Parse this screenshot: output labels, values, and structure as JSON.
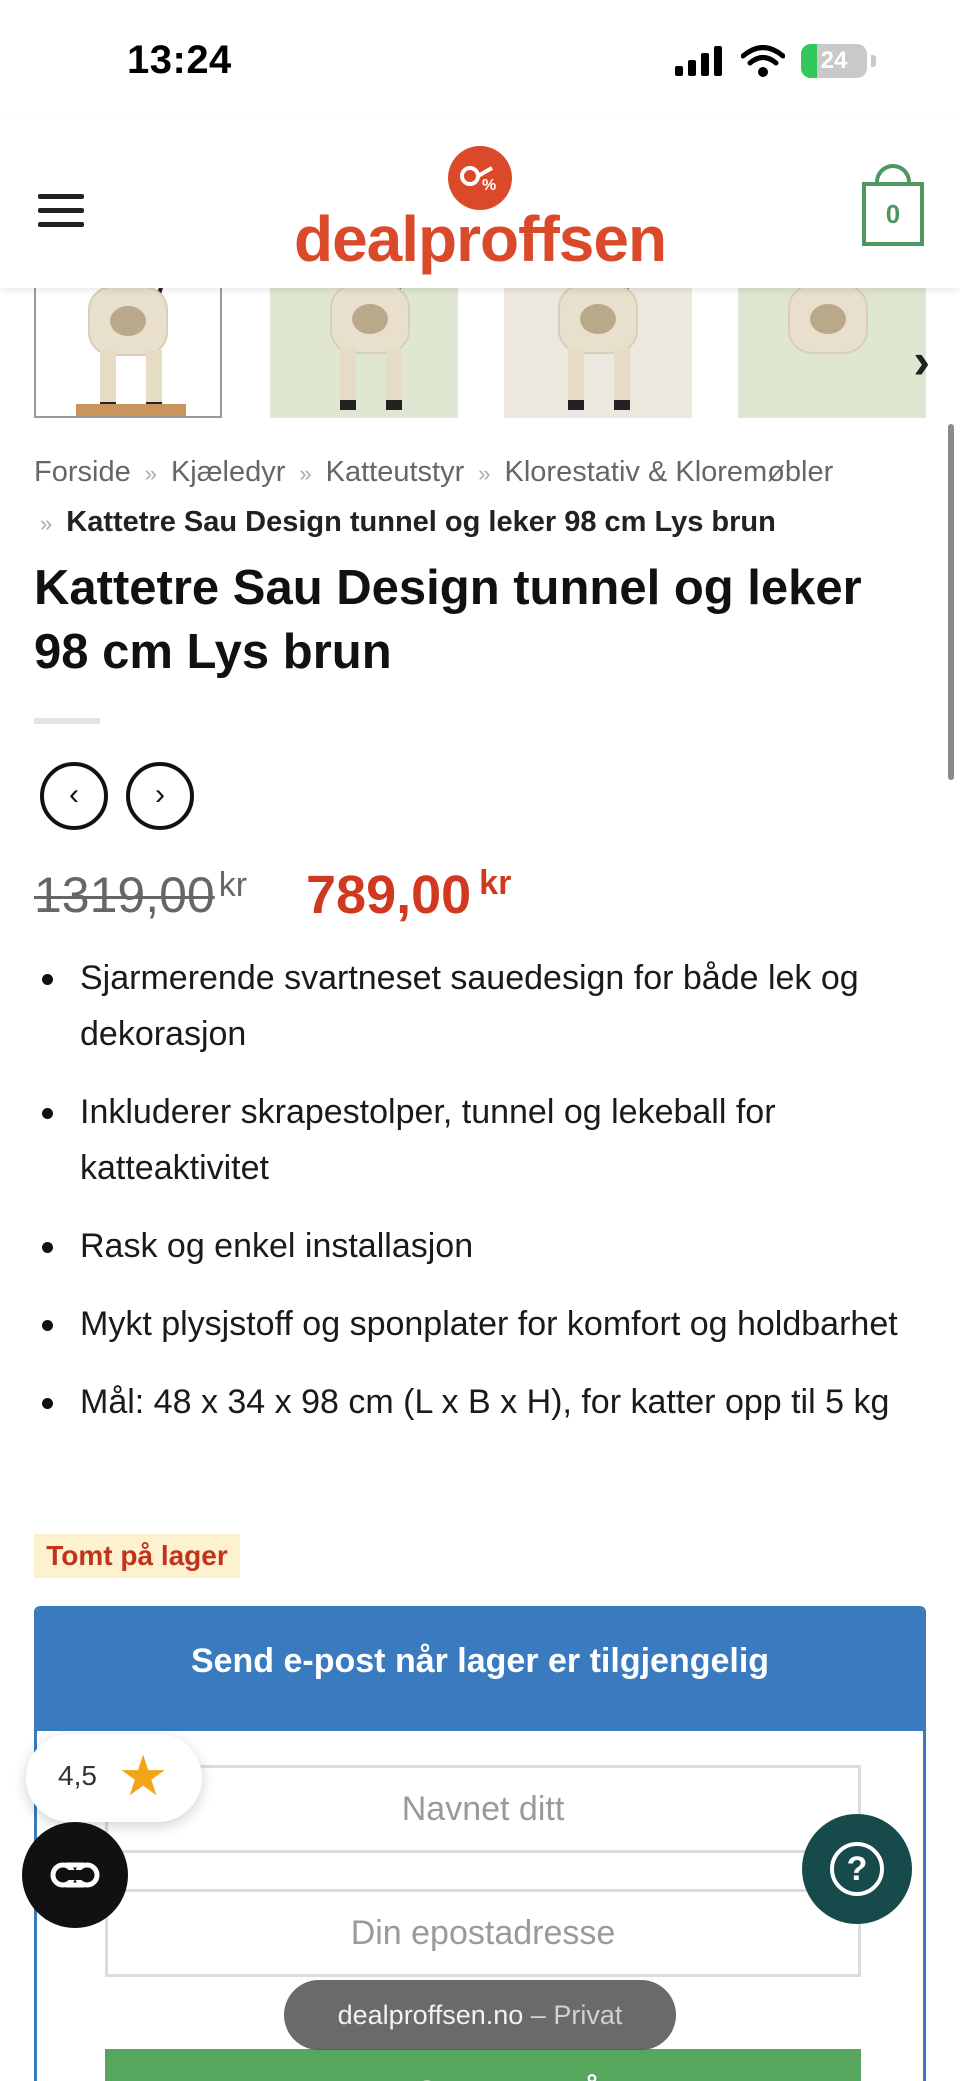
{
  "status_bar": {
    "time": "13:24",
    "battery": "24"
  },
  "header": {
    "logo_text": "dealproffsen",
    "cart_count": "0"
  },
  "breadcrumb": {
    "items": [
      "Forside",
      "Kjæledyr",
      "Katteutstyr",
      "Klorestativ & Kloremøbler"
    ],
    "current": "Kattetre Sau Design tunnel og leker 98 cm Lys brun",
    "separator": "»"
  },
  "product": {
    "title": "Kattetre Sau Design tunnel og leker 98 cm Lys brun",
    "old_price": "1319,00",
    "new_price": "789,00",
    "currency": "kr",
    "features": [
      "Sjarmerende svartneset sauedesign for både lek og dekorasjon",
      "Inkluderer skrapestolper, tunnel og lekeball for katteaktivitet",
      "Rask og enkel installasjon",
      "Mykt plysjstoff og sponplater for komfort og holdbarhet",
      "Mål: 48 x 34 x 98 cm (L x B x H), for katter opp til 5 kg"
    ],
    "stock_status": "Tomt på lager"
  },
  "notify": {
    "heading": "Send e-post når lager er tilgjengelig",
    "name_placeholder": "Navnet ditt",
    "email_placeholder": "Din epostadresse",
    "subscribe_label": "ABONNER NÅ"
  },
  "rating": {
    "value": "4,5"
  },
  "browser": {
    "domain": "dealproffsen.no",
    "mode": "Privat",
    "separator": "–"
  },
  "colors": {
    "brand": "#d9492a",
    "sale_price": "#d0391f",
    "notify_blue": "#3a7bc0",
    "subscribe_green": "#57a65e",
    "cart_green": "#4f9660",
    "help_teal": "#174a4b",
    "star": "#f2a516"
  },
  "icons": {
    "menu": "hamburger-icon",
    "cart": "shopping-bag-icon",
    "next_thumb": "chevron-right-icon",
    "prev": "chevron-left-icon",
    "next": "chevron-right-icon",
    "rating": "star-icon",
    "accessibility": "accessibility-icon",
    "help": "question-icon"
  }
}
